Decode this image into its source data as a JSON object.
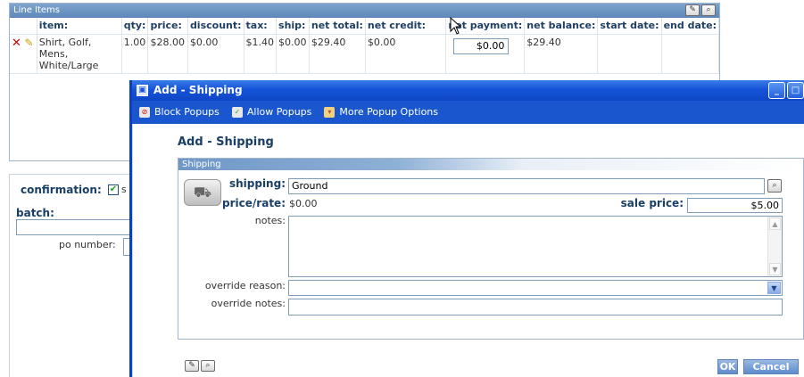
{
  "line_items": {
    "panel_title": "Line Items",
    "columns": [
      "item:",
      "qty:",
      "price:",
      "discount:",
      "tax:",
      "ship:",
      "net total:",
      "net credit:",
      "net payment:",
      "net balance:",
      "start date:",
      "end date:"
    ],
    "row": {
      "item": "Shirt, Golf, Mens, White/Large",
      "qty": "1.00",
      "price": "$28.00",
      "discount": "$0.00",
      "tax": "$1.40",
      "ship": "$0.00",
      "net_total": "$29.40",
      "net_credit": "$0.00",
      "net_payment": "$0.00",
      "net_balance": "$29.40",
      "start_date": "",
      "end_date": ""
    }
  },
  "bottom": {
    "confirmation_label": "confirmation:",
    "confirmation_tail": "s",
    "batch_label": "batch:",
    "po_label": "po number:"
  },
  "modal": {
    "title": "Add - Shipping",
    "popup_bar": {
      "block": "Block Popups",
      "allow": "Allow Popups",
      "more": "More Popup Options"
    },
    "form_title": "Add - Shipping",
    "section_title": "Shipping",
    "shipping_label": "shipping:",
    "shipping_value": "Ground",
    "price_rate_label": "price/rate:",
    "price_rate_value": "$0.00",
    "sale_price_label": "sale price:",
    "sale_price_value": "$5.00",
    "notes_label": "notes:",
    "notes_value": "",
    "override_reason_label": "override reason:",
    "override_reason_value": "",
    "override_notes_label": "override notes:",
    "override_notes_value": "",
    "ok_label": "OK",
    "cancel_label": "Cancel"
  },
  "colors": {
    "title_bar": "#1554d8",
    "popup_bar": "#1a57cf",
    "label_text": "#1a3f66",
    "balance_red": "#c00000"
  },
  "icons": [
    "delete-icon",
    "edit-icon",
    "search-icon",
    "truck-icon",
    "lookup-icon",
    "minimize-icon",
    "maximize-icon",
    "checkbox-checked-icon",
    "chevron-down-icon"
  ]
}
